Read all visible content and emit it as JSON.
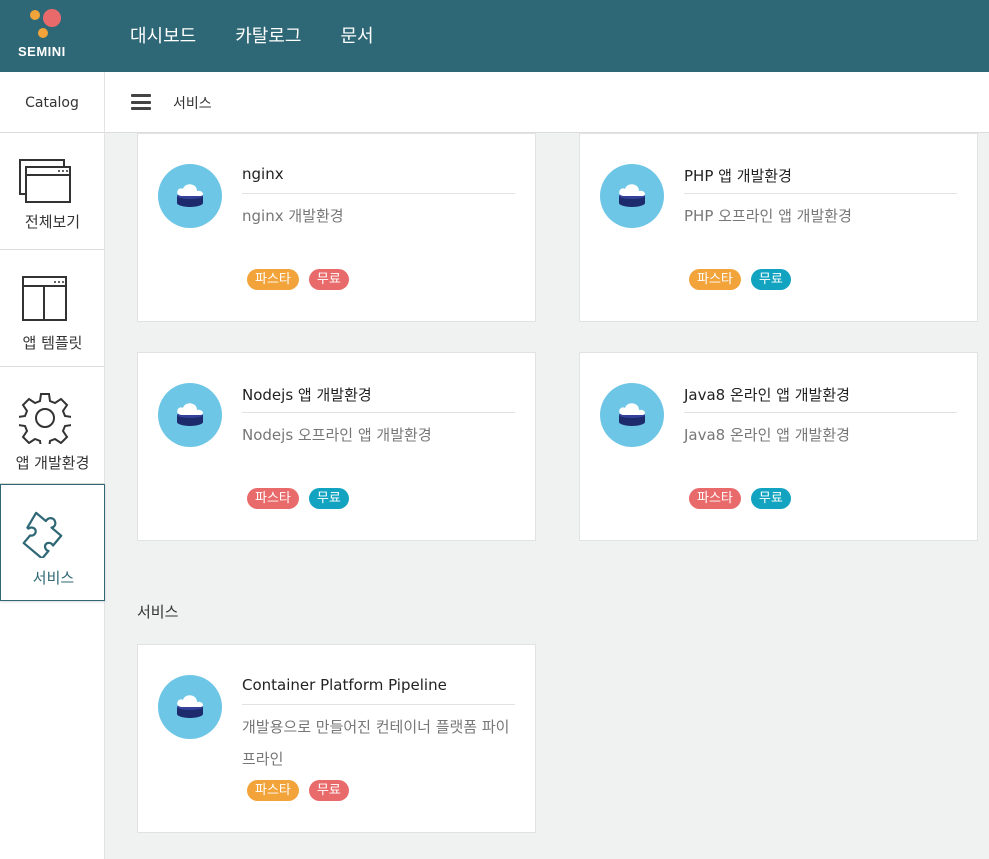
{
  "brand": {
    "name": "SEMINI"
  },
  "topnav": {
    "items": [
      "대시보드",
      "카탈로그",
      "문서"
    ]
  },
  "subbar": {
    "catalog_label": "Catalog",
    "title": "서비스"
  },
  "sidebar": {
    "items": [
      {
        "label": "전체보기",
        "icon": "all-view-icon"
      },
      {
        "label": "앱 템플릿",
        "icon": "app-template-icon"
      },
      {
        "label": "앱 개발환경",
        "icon": "gear-icon"
      },
      {
        "label": "서비스",
        "icon": "puzzle-icon",
        "active": true
      }
    ]
  },
  "cards": [
    {
      "title": "nginx",
      "description": "nginx 개발환경",
      "badges": [
        {
          "text": "파스타",
          "color": "#f2a43a"
        },
        {
          "text": "무료",
          "color": "#e96a6a"
        }
      ]
    },
    {
      "title": "PHP 앱 개발환경",
      "description": "PHP 오프라인 앱 개발환경",
      "badges": [
        {
          "text": "파스타",
          "color": "#f2a43a"
        },
        {
          "text": "무료",
          "color": "#12a3c1"
        }
      ]
    },
    {
      "title": "Nodejs 앱 개발환경",
      "description": "Nodejs 오프라인 앱 개발환경",
      "badges": [
        {
          "text": "파스타",
          "color": "#e96a6a"
        },
        {
          "text": "무료",
          "color": "#12a3c1"
        }
      ]
    },
    {
      "title": "Java8 온라인 앱 개발환경",
      "description": "Java8 온라인 앱 개발환경",
      "badges": [
        {
          "text": "파스타",
          "color": "#e96a6a"
        },
        {
          "text": "무료",
          "color": "#12a3c1"
        }
      ]
    }
  ],
  "service_section": {
    "title": "서비스",
    "cards": [
      {
        "title": "Container Platform Pipeline",
        "description": "개발용으로 만들어진 컨테이너 플랫폼 파이프라인",
        "badges": [
          {
            "text": "파스타",
            "color": "#f2a43a"
          },
          {
            "text": "무료",
            "color": "#e96a6a"
          }
        ]
      }
    ]
  },
  "colors": {
    "header": "#2e6775",
    "avatar": "#6ec6e6",
    "orange": "#f2a43a",
    "red": "#e96a6a",
    "teal": "#12a3c1"
  }
}
